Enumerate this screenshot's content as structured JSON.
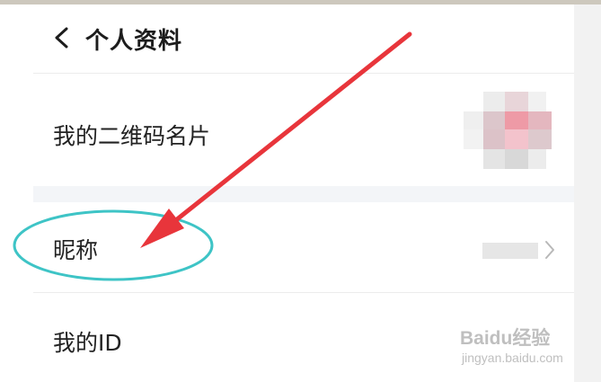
{
  "header": {
    "title": "个人资料"
  },
  "rows": [
    {
      "label": "我的二维码名片"
    },
    {
      "label": "昵称"
    },
    {
      "label": "我的ID"
    }
  ],
  "icons": {
    "back": "back-arrow-icon",
    "chevron": "chevron-right-icon"
  },
  "colors": {
    "annotation_arrow": "#e8353b",
    "annotation_ellipse": "#3ec4c6",
    "section_gap": "#f3f5f8",
    "title_text": "#1c1c1c"
  },
  "watermark": {
    "main": "Baidu经验",
    "sub": "jingyan.baidu.com"
  }
}
